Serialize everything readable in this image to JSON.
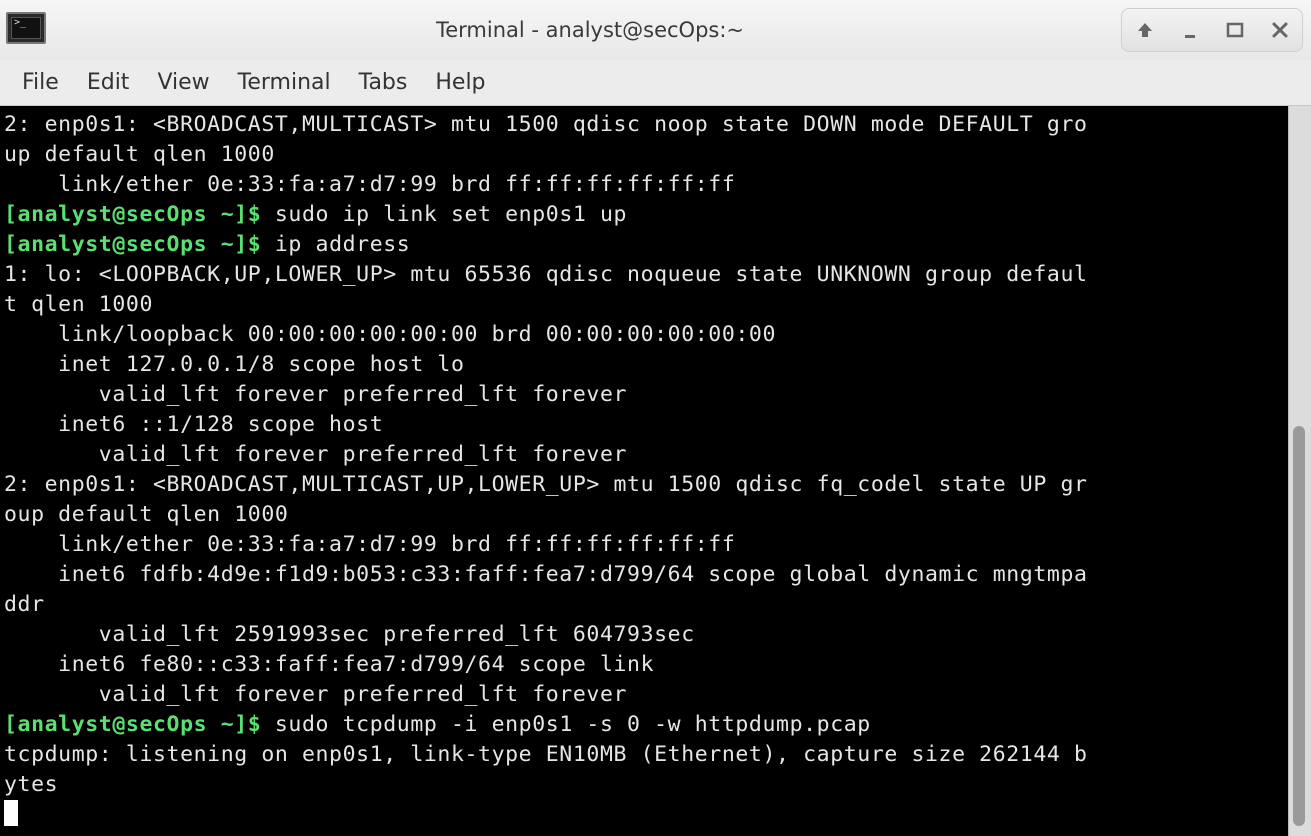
{
  "window": {
    "title": "Terminal - analyst@secOps:~",
    "icon": "terminal-icon"
  },
  "wm_controls": [
    {
      "name": "up-icon",
      "glyph": "⇧"
    },
    {
      "name": "minimize-icon",
      "glyph": "_"
    },
    {
      "name": "maximize-icon",
      "glyph": "☐"
    },
    {
      "name": "close-icon",
      "glyph": "✕"
    }
  ],
  "menu": [
    "File",
    "Edit",
    "View",
    "Terminal",
    "Tabs",
    "Help"
  ],
  "prompt": "[analyst@secOps ~]$",
  "terminal_lines": [
    {
      "text": "2: enp0s1: <BROADCAST,MULTICAST> mtu 1500 qdisc noop state DOWN mode DEFAULT gro"
    },
    {
      "text": "up default qlen 1000"
    },
    {
      "text": "    link/ether 0e:33:fa:a7:d7:99 brd ff:ff:ff:ff:ff:ff"
    },
    {
      "prompt": "[analyst@secOps ~]$",
      "text": " sudo ip link set enp0s1 up"
    },
    {
      "prompt": "[analyst@secOps ~]$",
      "text": " ip address"
    },
    {
      "text": "1: lo: <LOOPBACK,UP,LOWER_UP> mtu 65536 qdisc noqueue state UNKNOWN group defaul"
    },
    {
      "text": "t qlen 1000"
    },
    {
      "text": "    link/loopback 00:00:00:00:00:00 brd 00:00:00:00:00:00"
    },
    {
      "text": "    inet 127.0.0.1/8 scope host lo"
    },
    {
      "text": "       valid_lft forever preferred_lft forever"
    },
    {
      "text": "    inet6 ::1/128 scope host"
    },
    {
      "text": "       valid_lft forever preferred_lft forever"
    },
    {
      "text": "2: enp0s1: <BROADCAST,MULTICAST,UP,LOWER_UP> mtu 1500 qdisc fq_codel state UP gr"
    },
    {
      "text": "oup default qlen 1000"
    },
    {
      "text": "    link/ether 0e:33:fa:a7:d7:99 brd ff:ff:ff:ff:ff:ff"
    },
    {
      "text": "    inet6 fdfb:4d9e:f1d9:b053:c33:faff:fea7:d799/64 scope global dynamic mngtmpa"
    },
    {
      "text": "ddr"
    },
    {
      "text": "       valid_lft 2591993sec preferred_lft 604793sec"
    },
    {
      "text": "    inet6 fe80::c33:faff:fea7:d799/64 scope link"
    },
    {
      "text": "       valid_lft forever preferred_lft forever"
    },
    {
      "prompt": "[analyst@secOps ~]$",
      "text": " sudo tcpdump -i enp0s1 -s 0 -w httpdump.pcap"
    },
    {
      "text": "tcpdump: listening on enp0s1, link-type EN10MB (Ethernet), capture size 262144 b"
    },
    {
      "text": "ytes"
    },
    {
      "text": "",
      "cursor": true
    }
  ],
  "colors": {
    "prompt": "#58e070",
    "output": "#e6e6e6",
    "background": "#000000"
  }
}
